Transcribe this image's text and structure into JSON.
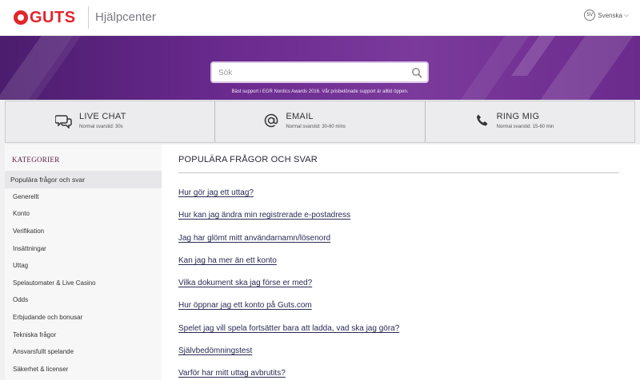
{
  "header": {
    "logo_text": "GUTS",
    "title": "Hjälpcenter",
    "language": {
      "code": "SV",
      "label": "Svenska"
    }
  },
  "hero": {
    "search_placeholder": "Sök",
    "tagline": "Bäst support i EGR Nordics Awards 2016. Vår prisbelönade support är alltid öppen."
  },
  "contact": [
    {
      "title": "LIVE CHAT",
      "subtitle": "Normal svarstid: 30s",
      "icon": "chat-icon"
    },
    {
      "title": "EMAIL",
      "subtitle": "Normal svarstid: 30-60 mins",
      "icon": "at-icon"
    },
    {
      "title": "RING MIG",
      "subtitle": "Normal svarstid: 15-60 min",
      "icon": "phone-icon"
    }
  ],
  "sidebar": {
    "heading": "KATEGORIER",
    "items": [
      "Populära frågor och svar",
      "Generellt",
      "Konto",
      "Verifikation",
      "Insättningar",
      "Uttag",
      "Spelautomater & Live Casino",
      "Odds",
      "Erbjudande och bonusar",
      "Tekniska frågor",
      "Ansvarsfullt spelande",
      "Säkerhet & licenser"
    ]
  },
  "main": {
    "title": "POPULÄRA FRÅGOR OCH SVAR",
    "faqs": [
      "Hur gör jag ett uttag?",
      "Hur kan jag ändra min registrerade e-postadress",
      "Jag har glömt mitt användarnamn/lösenord",
      "Kan jag ha mer än ett konto",
      "Vilka dokument ska jag förse er med?",
      "Hur öppnar jag ett konto på Guts.com",
      "Spelet jag vill spela fortsätter bara att ladda, vad ska jag göra?",
      "Självbedömningstest",
      "Varför har mitt uttag avbrutits?"
    ]
  },
  "colors": {
    "brand": "#e3242b",
    "hero_purple": "#6a2a8e",
    "link": "#2a2a55"
  }
}
